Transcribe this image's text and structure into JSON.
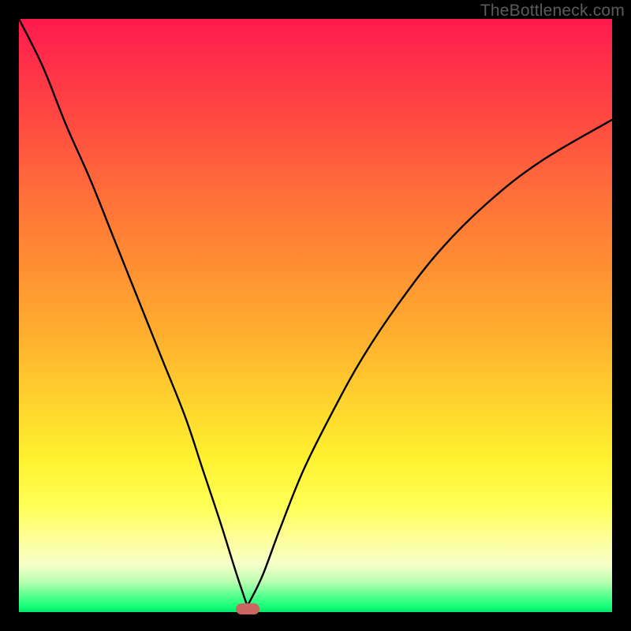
{
  "watermark_text": "TheBottleneck.com",
  "colors": {
    "frame": "#000000",
    "curve": "#000000",
    "marker": "#cb6762",
    "watermark": "#5b5b5b"
  },
  "chart_data": {
    "type": "line",
    "title": "",
    "xlabel": "",
    "ylabel": "",
    "xlim": [
      0,
      100
    ],
    "ylim": [
      0,
      100
    ],
    "note": "Cusp/V-shaped bottleneck curve. x is normalized horizontal position (0=left, 100=right). y is bottleneck severity (0=none/green at bottom, 100=max/red at top). Values estimated from pixel positions; no axes or ticks are rendered.",
    "series": [
      {
        "name": "left-branch",
        "x": [
          0,
          4,
          8,
          12,
          16,
          20,
          24,
          28,
          31,
          34,
          36.5,
          38.5
        ],
        "y": [
          100,
          92,
          82,
          73,
          63,
          53,
          43,
          33,
          24,
          15,
          7,
          1
        ]
      },
      {
        "name": "right-branch",
        "x": [
          38.5,
          41,
          44,
          48,
          53,
          58,
          64,
          71,
          79,
          88,
          100
        ],
        "y": [
          1,
          6,
          14,
          24,
          34,
          43,
          52,
          61,
          69,
          76,
          83
        ]
      }
    ],
    "marker": {
      "name": "optimal-point",
      "x": 38.5,
      "y": 0.5
    },
    "grid": false,
    "legend": false
  }
}
